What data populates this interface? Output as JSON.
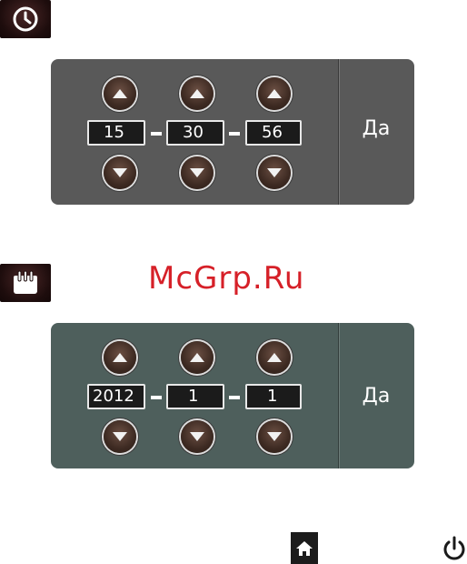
{
  "time_section": {
    "icon": "clock-icon",
    "hours": "15",
    "minutes": "30",
    "seconds": "56",
    "confirm_label": "Да"
  },
  "watermark": "McGrp.Ru",
  "date_section": {
    "icon": "calendar-icon",
    "year": "2012",
    "month": "1",
    "day": "1",
    "confirm_label": "Да"
  },
  "bottom_bar": {
    "home_icon": "home-icon",
    "power_icon": "power-icon"
  },
  "colors": {
    "time_panel": "#595959",
    "date_panel": "#4e5f5c",
    "watermark": "#d62028"
  }
}
